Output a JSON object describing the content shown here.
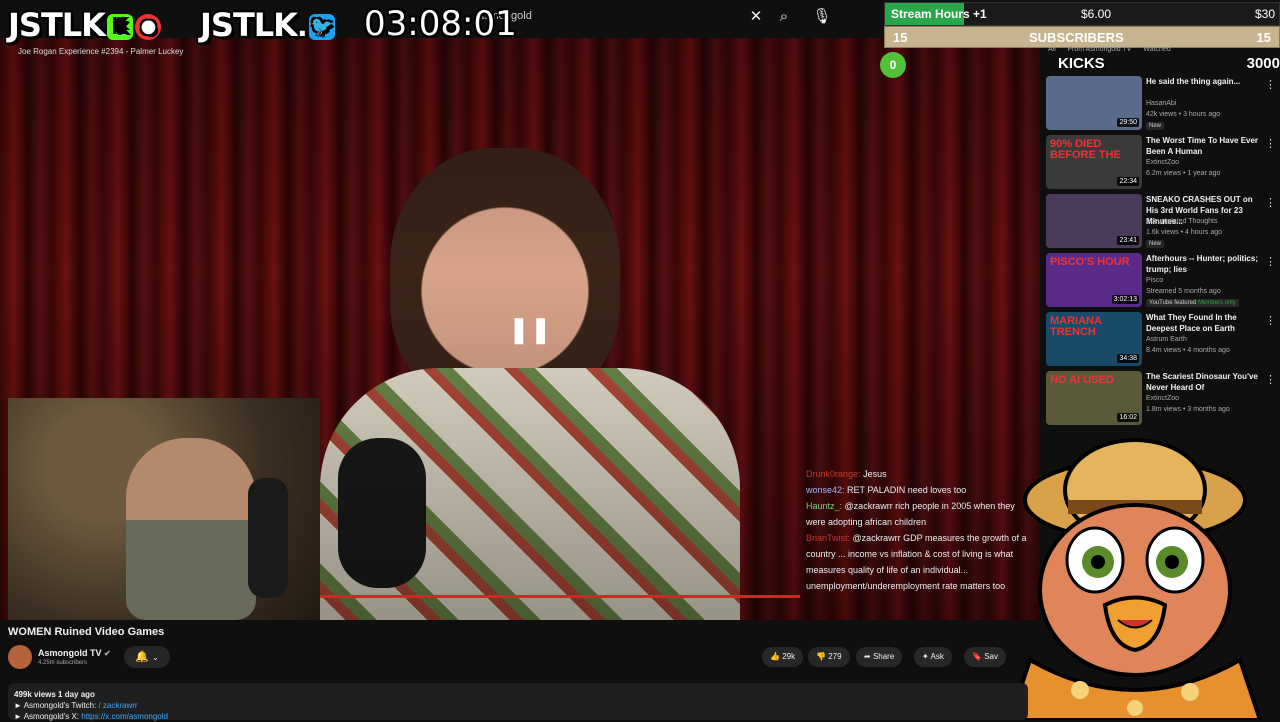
{
  "topbar": {
    "search_value": "asmongold",
    "clear_icon": "close-icon",
    "search_icon": "search-icon",
    "mic_icon": "microphone-icon"
  },
  "overlay": {
    "logo_left": "JSTLK",
    "logo_right": "JSTLK",
    "timer": "03:08:01",
    "episode": "Joe Rogan Experience #2394 - Palmer Luckey"
  },
  "stream_hours": {
    "label": "Stream Hours",
    "increment": "+1",
    "mid_value": "$6.00",
    "right_value": "$30",
    "fill_fraction": 0.2
  },
  "subscribers": {
    "left": "15",
    "label": "SUBSCRIBERS",
    "right": "15"
  },
  "kicks": {
    "current": "0",
    "label": "KICKS",
    "target": "3000"
  },
  "chips": [
    "All",
    "From Asmongold TV",
    "Watched"
  ],
  "chat": [
    {
      "user": "Drunk0range:",
      "text": "Jesus",
      "color": "red"
    },
    {
      "user": "wonse42:",
      "text": "RET PALADIN need loves too",
      "color": "blue"
    },
    {
      "user": "Hauntz_:",
      "text": "@zackrawrr rich people in 2005 when they were adopting african children",
      "color": "green"
    },
    {
      "user": "BrianTwist:",
      "text": "@zackrawrr GDP measures the growth of a country ... income vs inflation & cost of living is what measures quality of life of an individual... unemployment/underemployment rate matters too",
      "color": "red"
    }
  ],
  "recommendations": [
    {
      "title": "He said the thing again...",
      "channel": "HasanAbi",
      "meta": "42k views • 3 hours ago",
      "badge": "New",
      "duration": "29:50",
      "thumb_text": "",
      "thumb_color": "#5a6a8a"
    },
    {
      "title": "The Worst Time To Have Ever Been A Human",
      "channel": "ExtinctZoo",
      "meta": "6.2m views • 1 year ago",
      "badge": "",
      "duration": "22:34",
      "thumb_text": "90% DIED BEFORE THE",
      "thumb_color": "#3a3a3a"
    },
    {
      "title": "SNEAKO CRASHES OUT on His 3rd World Fans for 23 Minutes...",
      "channel": "Accumulated Thoughts",
      "meta": "1.6k views • 4 hours ago",
      "badge": "New",
      "duration": "23:41",
      "thumb_text": "",
      "thumb_color": "#4a3a5a"
    },
    {
      "title": "Afterhours -- Hunter; politics; trump; lies",
      "channel": "Pisco",
      "meta": "Streamed 5 months ago",
      "badge": "YouTube featured",
      "members": "Members only",
      "duration": "3:02:13",
      "thumb_text": "PISCO'S HOUR",
      "thumb_color": "#5a2a8a"
    },
    {
      "title": "What They Found In the Deepest Place on Earth",
      "channel": "Astrum Earth",
      "meta": "8.4m views • 4 months ago",
      "badge": "",
      "duration": "34:38",
      "thumb_text": "MARIANA TRENCH",
      "thumb_color": "#1a4a6a"
    },
    {
      "title": "The Scariest Dinosaur You've Never Heard Of",
      "channel": "ExtinctZoo",
      "meta": "1.8m views • 3 months ago",
      "badge": "",
      "duration": "16:02",
      "thumb_text": "NO AI USED",
      "thumb_color": "#5a5a3a"
    }
  ],
  "video": {
    "title": "WOMEN Ruined Video Games",
    "channel": "Asmongold TV",
    "subscribers": "4.25m subscribers",
    "likes": "29k",
    "dislikes": "279",
    "share": "Share",
    "ask": "Ask",
    "save": "Sav",
    "views": "499k views  1 day ago",
    "desc_line1": "► Asmongold's Twitch:",
    "desc_twitch": "/ zackrawrr",
    "desc_line2": "► Asmongold's X:",
    "desc_x_link": "https://x.com/asmongold"
  }
}
